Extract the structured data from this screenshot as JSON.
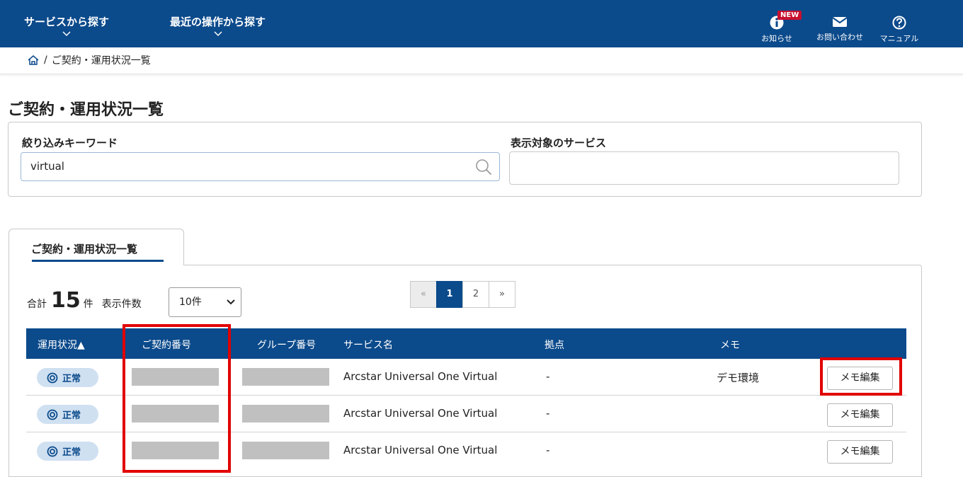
{
  "header": {
    "nav_service": "サービスから探す",
    "nav_recent": "最近の操作から探す",
    "news_label": "お知らせ",
    "news_badge": "NEW",
    "contact_label": "お問い合わせ",
    "manual_label": "マニュアル",
    "brand_color": "#0b4a8b"
  },
  "breadcrumb": {
    "separator": "/",
    "current": "ご契約・運用状況一覧"
  },
  "page_title": "ご契約・運用状況一覧",
  "filter": {
    "keyword_label": "絞り込みキーワード",
    "keyword_value": "virtual",
    "service_label": "表示対象のサービス",
    "service_value": ""
  },
  "tab": {
    "label": "ご契約・運用状況一覧"
  },
  "summary": {
    "total_prefix": "合計",
    "total_count": "15",
    "total_unit": "件",
    "per_page_label": "表示件数",
    "per_page_value": "10件"
  },
  "pager": {
    "prev": "«",
    "pages": [
      "1",
      "2"
    ],
    "next": "»",
    "current": "1"
  },
  "table": {
    "headers": {
      "status": "運用状況▲",
      "contract": "ご契約番号",
      "group": "グループ番号",
      "service": "サービス名",
      "site": "拠点",
      "memo": "メモ"
    },
    "rows": [
      {
        "status": "正常",
        "service": "Arcstar Universal One Virtual",
        "site": "-",
        "memo": "デモ環境",
        "button": "メモ編集"
      },
      {
        "status": "正常",
        "service": "Arcstar Universal One Virtual",
        "site": "-",
        "memo": "",
        "button": "メモ編集"
      },
      {
        "status": "正常",
        "service": "Arcstar Universal One Virtual",
        "site": "-",
        "memo": "",
        "button": "メモ編集"
      }
    ]
  },
  "highlight_color": "#e10000"
}
